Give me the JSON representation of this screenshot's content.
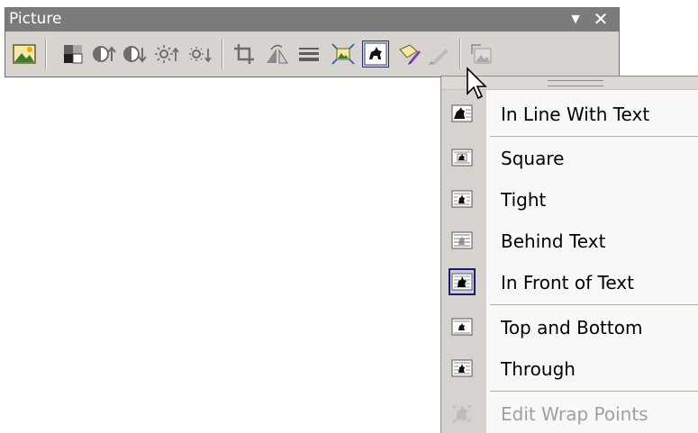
{
  "toolbar": {
    "title": "Picture",
    "buttons": [
      {
        "name": "insert-picture"
      },
      {
        "name": "color"
      },
      {
        "name": "more-contrast"
      },
      {
        "name": "less-contrast"
      },
      {
        "name": "more-brightness"
      },
      {
        "name": "less-brightness"
      },
      {
        "name": "crop"
      },
      {
        "name": "rotate-left"
      },
      {
        "name": "line-style"
      },
      {
        "name": "compress-pictures"
      },
      {
        "name": "text-wrapping"
      },
      {
        "name": "format-picture"
      },
      {
        "name": "set-transparent-color"
      },
      {
        "name": "reset-picture"
      }
    ]
  },
  "menu": {
    "items": [
      {
        "label": "In Line With Text",
        "enabled": true,
        "checked": false
      },
      {
        "label": "Square",
        "enabled": true,
        "checked": false
      },
      {
        "label": "Tight",
        "enabled": true,
        "checked": false
      },
      {
        "label": "Behind Text",
        "enabled": true,
        "checked": false
      },
      {
        "label": "In Front of Text",
        "enabled": true,
        "checked": true
      },
      {
        "label": "Top and Bottom",
        "enabled": true,
        "checked": false
      },
      {
        "label": "Through",
        "enabled": true,
        "checked": false
      },
      {
        "label": "Edit Wrap Points",
        "enabled": false,
        "checked": false
      }
    ]
  },
  "colors": {
    "title_bar": "#7b7b7b",
    "toolbar_bg": "#d7d4cf",
    "menu_bg": "#f9f8f7",
    "gutter": "#d6d3ce",
    "checked_border": "#1c1c6b",
    "disabled_text": "#a0a0a0"
  }
}
